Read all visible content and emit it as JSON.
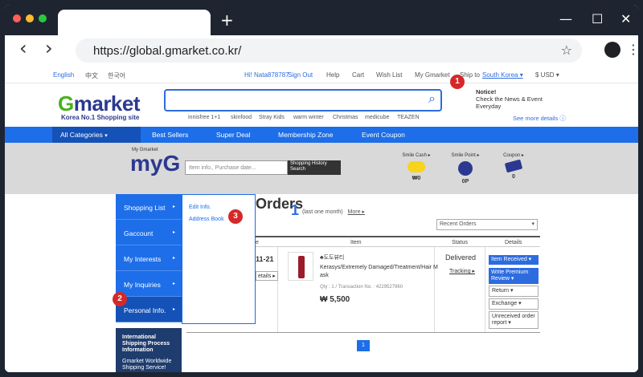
{
  "browser": {
    "url": "https://global.gmarket.co.kr/",
    "new_tab": "+",
    "win_min": "—",
    "win_max": "☐",
    "win_close": "✕",
    "back": "‹",
    "forward": "›",
    "star": "☆",
    "menu": "⋮"
  },
  "topbar": {
    "lang_en": "English",
    "lang_zh": "中文",
    "lang_ko": "한국어",
    "greeting": "Hi! Nata878787",
    "sign_out": "Sign Out",
    "help": "Help",
    "cart": "Cart",
    "wish_list": "Wish List",
    "my_gmarket": "My Gmarket",
    "ship_to": "Ship to",
    "country": "South Korea ▾",
    "currency": "$ USD ▾"
  },
  "header": {
    "logo_g": "G",
    "logo_rest": "market",
    "tagline": "Korea No.1 Shopping site",
    "search_icon": "⌕",
    "keywords": [
      "innisfree 1+1",
      "skinfood",
      "Stray Kids",
      "warm winter",
      "Christmas",
      "medicube",
      "TEAZEN"
    ],
    "notice_title": "Notice!",
    "notice_line1": "Check the News & Event",
    "notice_line2": "Everyday",
    "see_more": "See more details ⓘ"
  },
  "catbar": {
    "all": "All Categories",
    "all_arrow": "▾",
    "menus": [
      "Best Sellers",
      "Super Deal",
      "Membership Zone",
      "Event Coupon"
    ]
  },
  "myg": {
    "small": "My Gmarket",
    "big": "myG",
    "search_placeholder": "Item info., Purchase date...",
    "history_btn": "Shopping History Search",
    "smile_cash_label": "Smile Cash ▸",
    "smile_cash_value": "₩0",
    "smile_point_label": "Smile Point ▸",
    "smile_point_value": "0P",
    "coupon_label": "Coupon ▸",
    "coupon_value": "0"
  },
  "orders": {
    "title": "Orders",
    "count": "1",
    "range": "(last one month)",
    "more": "More ▸",
    "sort": "Recent Orders",
    "col_date": "e",
    "col_item": "Item",
    "col_status": "Status",
    "col_details": "Details",
    "order_date": "11-21",
    "details_small": "etails ▸",
    "seller": "♣도도뷰티",
    "product_line1": "Kerasys/Extremely Damaged/Treatment/Hair M",
    "product_line2": "ask",
    "qty": "Qty : 1 / Transaction No. : 4229527960",
    "price": "₩ 5,500",
    "status": "Delivered",
    "tracking": "Tracking ▸",
    "btn_received": "Item Received ▾",
    "btn_review": "Write Premium Review ▾",
    "btn_return": "Return ▾",
    "btn_exchange": "Exchange ▾",
    "btn_unreceived": "Unreceived order report ▾",
    "page": "1"
  },
  "sidenav": {
    "items": [
      "Shopping List",
      "Gaccount",
      "My Interests",
      "My Inquiries",
      "Personal Info."
    ],
    "arrow": "▸",
    "sub": [
      "Edit Info.",
      "Address Book"
    ],
    "banner_title": "International Shipping Process Information",
    "banner_sub": "Gmarket Worldwide Shipping Service!"
  },
  "badges": [
    "1",
    "2",
    "3"
  ],
  "colors": {
    "accent": "#1d6ee8",
    "badge": "#d62828",
    "logo_green": "#49b020",
    "logo_blue": "#2b3990"
  }
}
